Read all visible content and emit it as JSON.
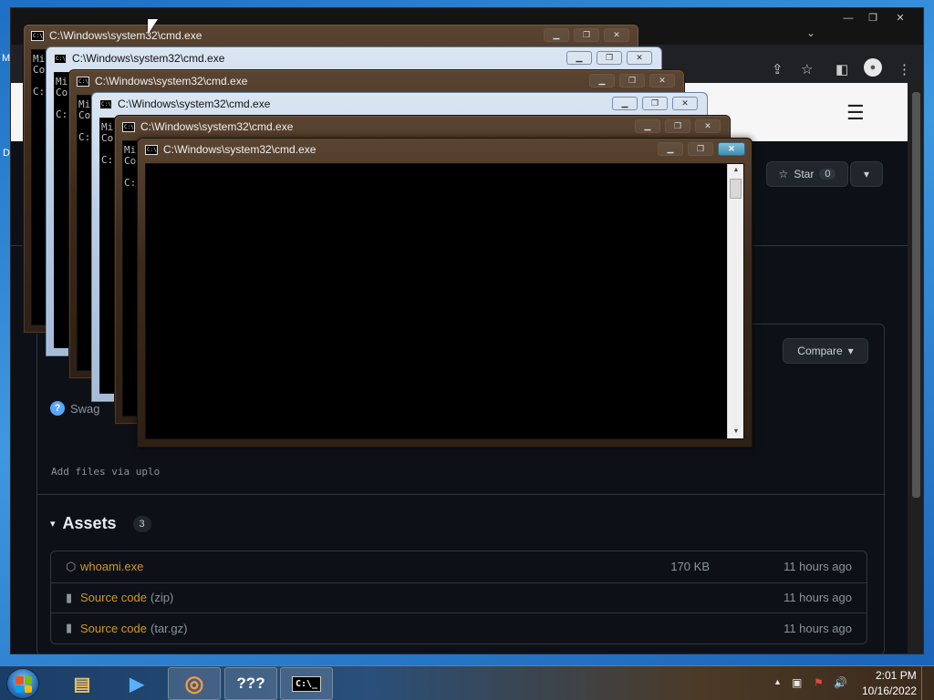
{
  "desktop": {
    "labels": [
      "M",
      "D"
    ]
  },
  "browser": {
    "window_controls": [
      "—",
      "❐",
      "✕"
    ],
    "tab_dropdown_glyph": "⌄",
    "toolbar_glyphs": [
      "⇪",
      "☆",
      "◧",
      "●",
      "⋮"
    ]
  },
  "github": {
    "menu_glyph": "☰",
    "star_label": "Star",
    "star_count": "0",
    "star_dropdown_glyph": "▾",
    "compare_label": "Compare",
    "compare_caret": "▾",
    "swag_glyph": "?",
    "swag_label": "Swag",
    "add_files_hint": "Add files via uplo",
    "assets": {
      "caret": "▾",
      "title": "Assets",
      "count": "3",
      "items": [
        {
          "icon": "package-icon",
          "glyph": "⬡",
          "name": "whoami.exe",
          "suffix": "",
          "size": "170 KB",
          "date": "11 hours ago"
        },
        {
          "icon": "file-zip-icon",
          "glyph": "▮",
          "name": "Source code",
          "suffix": "(zip)",
          "size": "",
          "date": "11 hours ago"
        },
        {
          "icon": "file-zip-icon",
          "glyph": "▮",
          "name": "Source code",
          "suffix": "(tar.gz)",
          "size": "",
          "date": "11 hours ago"
        }
      ]
    }
  },
  "cmd_windows": [
    {
      "title": "C:\\Windows\\system32\\cmd.exe",
      "lines": [
        "Mi",
        "Co",
        "",
        "C:"
      ]
    },
    {
      "title": "C:\\Windows\\system32\\cmd.exe",
      "lines": [
        "Mi",
        "Co",
        "",
        "C:"
      ]
    },
    {
      "title": "C:\\Windows\\system32\\cmd.exe",
      "lines": [
        "Mi",
        "Co",
        "",
        "C:"
      ]
    },
    {
      "title": "C:\\Windows\\system32\\cmd.exe",
      "lines": [
        "Mi",
        "Co",
        "",
        "C:"
      ]
    },
    {
      "title": "C:\\Windows\\system32\\cmd.exe",
      "lines": [
        "Mi",
        "Co",
        "",
        "C:"
      ]
    },
    {
      "title": "C:\\Windows\\system32\\cmd.exe",
      "lines": []
    }
  ],
  "cmd_controls": {
    "minimize": "▁",
    "maximize": "❐",
    "close": "✕"
  },
  "cmd_icon_text": "C:\\",
  "cmd_scroll": {
    "up": "▲",
    "down": "▼"
  },
  "taskbar": {
    "buttons": [
      {
        "name": "explorer-taskbar-button",
        "icon": "folder-icon",
        "glyph": "▤",
        "active": false
      },
      {
        "name": "media-player-taskbar-button",
        "icon": "media-player-icon",
        "glyph": "▶",
        "active": false
      },
      {
        "name": "browser-taskbar-button",
        "icon": "chrome-icon",
        "glyph": "◎",
        "active": true
      },
      {
        "name": "unknown-app-taskbar-button",
        "icon": "question-icon",
        "glyph": "???",
        "active": true
      },
      {
        "name": "cmd-taskbar-button",
        "icon": "cmd-icon",
        "glyph": "C:\\_",
        "active": true
      }
    ],
    "tray_glyphs": [
      "▲",
      "▣",
      "⚑",
      "🔊"
    ],
    "clock_time": "2:01 PM",
    "clock_date": "10/16/2022",
    "start_flag_colors": [
      "#f25022",
      "#7fba00",
      "#00a4ef",
      "#ffb900"
    ]
  }
}
